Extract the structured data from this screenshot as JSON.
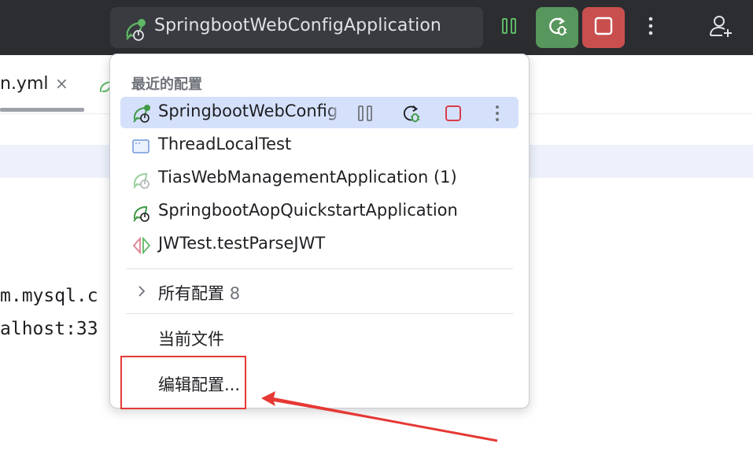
{
  "toolbar": {
    "run_config_name": "SpringbootWebConfigApplication",
    "accent_run": "#57965c",
    "accent_stop": "#c94f4f"
  },
  "editor": {
    "tab_file": "n.yml",
    "tab_close": "×",
    "code_lines": [
      "m.mysql.c",
      "alhost:33"
    ]
  },
  "popup": {
    "title": "最近的配置",
    "recent": [
      {
        "label": "SpringbootWebConfig",
        "icon": "spring-boot-running-icon",
        "selected": true
      },
      {
        "label": "ThreadLocalTest",
        "icon": "application-icon"
      },
      {
        "label": "TiasWebManagementApplication (1)",
        "icon": "spring-boot-inactive-icon"
      },
      {
        "label": "SpringbootAopQuickstartApplication",
        "icon": "spring-boot-icon"
      },
      {
        "label": "JWTest.testParseJWT",
        "icon": "junit-test-icon"
      }
    ],
    "all_configs_label": "所有配置",
    "all_configs_count": "8",
    "current_file_label": "当前文件",
    "edit_configs_label": "编辑配置..."
  }
}
